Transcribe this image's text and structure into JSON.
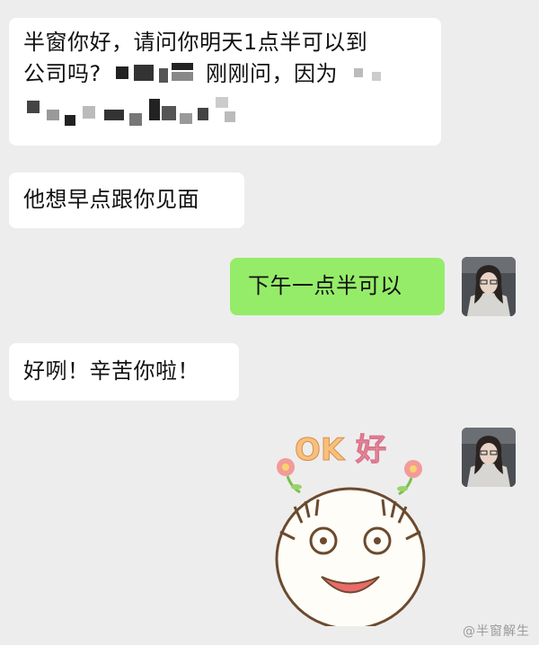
{
  "chat": {
    "messages": [
      {
        "side": "left",
        "line1": "半窗你好，请问你明天1点半可以到",
        "line2_a": "公司吗?",
        "line2_b": "刚刚问，因为"
      },
      {
        "side": "left",
        "text": "他想早点跟你见面"
      },
      {
        "side": "right",
        "text": "下午一点半可以"
      },
      {
        "side": "left",
        "text": "好咧！辛苦你啦！"
      },
      {
        "side": "right",
        "sticker": {
          "text_ok": "OK",
          "text_hao": "好",
          "icon": "smiling-bear-sticker-icon"
        }
      }
    ]
  },
  "watermark": {
    "text": "@半窗解生"
  },
  "colors": {
    "background": "#ededed",
    "left_bubble": "#ffffff",
    "right_bubble": "#95ec69"
  }
}
